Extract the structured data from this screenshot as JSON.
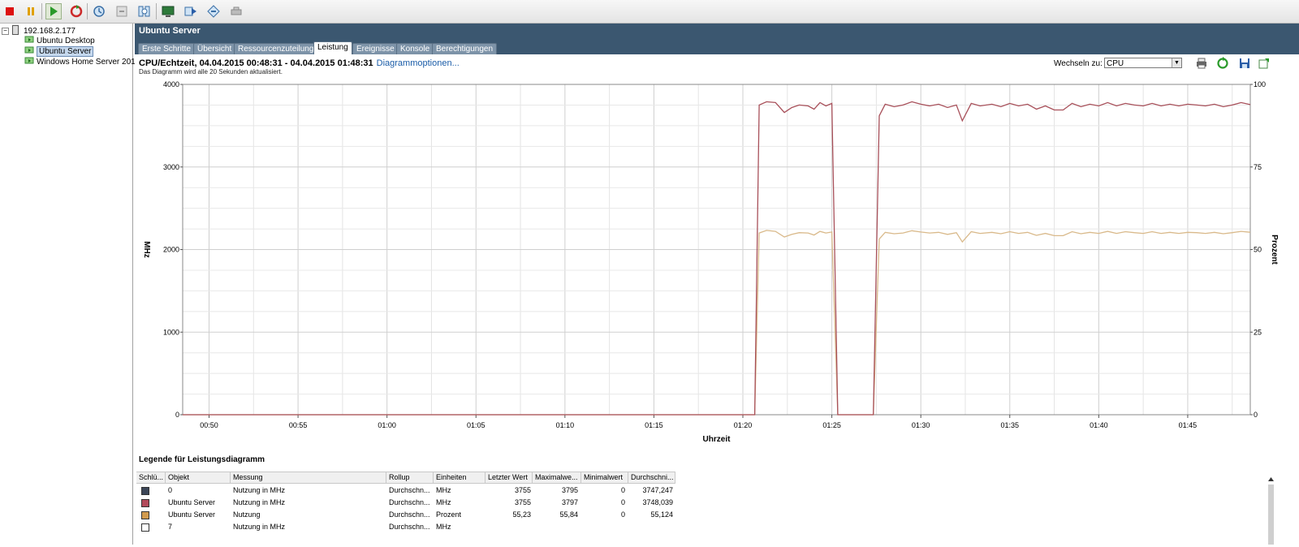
{
  "toolbar": {
    "buttons": [
      "stop-icon",
      "pause-icon",
      "play-icon",
      "reset-icon",
      "snapshot-icon",
      "revert-snapshot-icon",
      "snapshot-manager-icon",
      "console-icon",
      "migrate-icon",
      "clone-icon",
      "tools-icon"
    ]
  },
  "tree": {
    "host": "192.168.2.177",
    "items": [
      "Ubuntu Desktop",
      "Ubuntu Server",
      "Windows Home Server 201"
    ],
    "selected": "Ubuntu Server"
  },
  "panel": {
    "title": "Ubuntu Server",
    "tabs": [
      "Erste Schritte",
      "Übersicht",
      "Ressourcenzuteilung",
      "Leistung",
      "Ereignisse",
      "Konsole",
      "Berechtigungen"
    ],
    "active_tab": "Leistung"
  },
  "perf": {
    "title": "CPU/Echtzeit, 04.04.2015 00:48:31 - 04.04.2015 01:48:31",
    "options_link": "Diagrammoptionen...",
    "subtitle": "Das Diagramm wird alle 20 Sekunden aktualisiert.",
    "switch_label": "Wechseln zu:",
    "switch_value": "CPU"
  },
  "chart_data": {
    "type": "line",
    "xlabel": "Uhrzeit",
    "ylabel_left": "MHz",
    "ylabel_right": "Prozent",
    "ylim_left": [
      0,
      4000
    ],
    "ylim_right": [
      0,
      100
    ],
    "yticks_left": [
      "0",
      "1000",
      "2000",
      "3000",
      "4000"
    ],
    "yticks_right": [
      "0",
      "25",
      "50",
      "75",
      "100"
    ],
    "xticks": [
      "00:50",
      "00:55",
      "01:00",
      "01:05",
      "01:10",
      "01:15",
      "01:20",
      "01:25",
      "01:30",
      "01:35",
      "01:40",
      "01:45"
    ],
    "x_minutes_range": [
      "00:48:31",
      "01:48:31"
    ],
    "grid": true,
    "series": [
      {
        "name": "Ubuntu Server Nutzung in MHz",
        "axis": "left",
        "color": "#a8505a",
        "x": [
          "00:48:31",
          "01:20:40",
          "01:20:55",
          "01:21:20",
          "01:21:50",
          "01:22:20",
          "01:22:45",
          "01:23:10",
          "01:23:40",
          "01:24:00",
          "01:24:20",
          "01:24:40",
          "01:25:00",
          "01:25:20",
          "01:27:20",
          "01:27:40",
          "01:28:00",
          "01:28:30",
          "01:29:00",
          "01:29:30",
          "01:30:00",
          "01:30:30",
          "01:31:00",
          "01:31:30",
          "01:32:00",
          "01:32:20",
          "01:32:50",
          "01:33:20",
          "01:34:00",
          "01:34:30",
          "01:35:00",
          "01:35:30",
          "01:36:00",
          "01:36:30",
          "01:37:00",
          "01:37:30",
          "01:38:00",
          "01:38:30",
          "01:39:00",
          "01:39:30",
          "01:40:00",
          "01:40:30",
          "01:41:00",
          "01:41:30",
          "01:42:00",
          "01:42:30",
          "01:43:00",
          "01:43:30",
          "01:44:00",
          "01:44:30",
          "01:45:00",
          "01:45:30",
          "01:46:00",
          "01:46:30",
          "01:47:00",
          "01:47:30",
          "01:48:00",
          "01:48:31"
        ],
        "values": [
          0,
          0,
          3750,
          3790,
          3780,
          3660,
          3720,
          3750,
          3740,
          3700,
          3780,
          3740,
          3770,
          0,
          0,
          3620,
          3760,
          3730,
          3750,
          3790,
          3760,
          3740,
          3760,
          3720,
          3750,
          3560,
          3770,
          3740,
          3760,
          3730,
          3770,
          3740,
          3760,
          3700,
          3740,
          3690,
          3690,
          3770,
          3730,
          3760,
          3740,
          3780,
          3740,
          3770,
          3750,
          3740,
          3770,
          3740,
          3760,
          3740,
          3760,
          3750,
          3740,
          3760,
          3730,
          3750,
          3780,
          3755
        ]
      },
      {
        "name": "Ubuntu Server Nutzung",
        "axis": "right",
        "color": "#d9b98a",
        "x": [
          "00:48:31",
          "01:20:40",
          "01:20:55",
          "01:21:20",
          "01:21:50",
          "01:22:20",
          "01:22:45",
          "01:23:10",
          "01:23:40",
          "01:24:00",
          "01:24:20",
          "01:24:40",
          "01:25:00",
          "01:25:20",
          "01:27:20",
          "01:27:40",
          "01:28:00",
          "01:28:30",
          "01:29:00",
          "01:29:30",
          "01:30:00",
          "01:30:30",
          "01:31:00",
          "01:31:30",
          "01:32:00",
          "01:32:20",
          "01:32:50",
          "01:33:20",
          "01:34:00",
          "01:34:30",
          "01:35:00",
          "01:35:30",
          "01:36:00",
          "01:36:30",
          "01:37:00",
          "01:37:30",
          "01:38:00",
          "01:38:30",
          "01:39:00",
          "01:39:30",
          "01:40:00",
          "01:40:30",
          "01:41:00",
          "01:41:30",
          "01:42:00",
          "01:42:30",
          "01:43:00",
          "01:43:30",
          "01:44:00",
          "01:44:30",
          "01:45:00",
          "01:45:30",
          "01:46:00",
          "01:46:30",
          "01:47:00",
          "01:47:30",
          "01:48:00",
          "01:48:31"
        ],
        "values": [
          0,
          0,
          55.0,
          55.8,
          55.5,
          53.8,
          54.6,
          55.1,
          55.0,
          54.4,
          55.5,
          55.0,
          55.3,
          0,
          0,
          53.2,
          55.2,
          54.8,
          55.0,
          55.7,
          55.3,
          55.0,
          55.2,
          54.6,
          55.1,
          52.3,
          55.4,
          54.9,
          55.2,
          54.8,
          55.4,
          54.9,
          55.2,
          54.3,
          54.9,
          54.2,
          54.2,
          55.4,
          54.8,
          55.2,
          54.9,
          55.5,
          54.9,
          55.4,
          55.1,
          54.9,
          55.4,
          54.9,
          55.2,
          54.9,
          55.2,
          55.1,
          54.9,
          55.2,
          54.8,
          55.1,
          55.5,
          55.23
        ]
      }
    ]
  },
  "legend": {
    "title": "Legende für Leistungsdiagramm",
    "columns": [
      "Schlü...",
      "Objekt",
      "Messung",
      "Rollup",
      "Einheiten",
      "Letzter Wert",
      "Maximalwe...",
      "Minimalwert",
      "Durchschni..."
    ],
    "rows": [
      {
        "color": "#3c4658",
        "object": "0",
        "measure": "Nutzung in MHz",
        "rollup": "Durchschn...",
        "unit": "MHz",
        "last": "3755",
        "max": "3795",
        "min": "0",
        "avg": "3747,247"
      },
      {
        "color": "#b24a5a",
        "object": "Ubuntu Server",
        "measure": "Nutzung in MHz",
        "rollup": "Durchschn...",
        "unit": "MHz",
        "last": "3755",
        "max": "3797",
        "min": "0",
        "avg": "3748,039"
      },
      {
        "color": "#d19a4e",
        "object": "Ubuntu Server",
        "measure": "Nutzung",
        "rollup": "Durchschn...",
        "unit": "Prozent",
        "last": "55,23",
        "max": "55,84",
        "min": "0",
        "avg": "55,124"
      },
      {
        "color": "#ffffff",
        "object": "7",
        "measure": "Nutzung in MHz",
        "rollup": "Durchschn...",
        "unit": "MHz",
        "last": "",
        "max": "",
        "min": "",
        "avg": ""
      }
    ]
  }
}
